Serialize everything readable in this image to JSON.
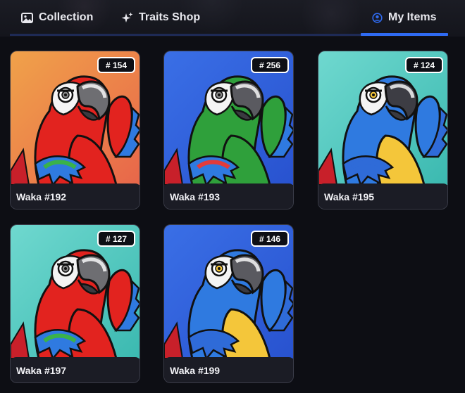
{
  "tabs": [
    {
      "label": "Collection",
      "icon": "image-icon",
      "active": false
    },
    {
      "label": "Traits Shop",
      "icon": "sparkles-icon",
      "active": false
    },
    {
      "label": "My Items",
      "icon": "user-circle-icon",
      "active": true
    }
  ],
  "colors": {
    "active_tab": "#2f6bf2",
    "background": "#0d0e14",
    "card_footer": "#1b1c25"
  },
  "items": [
    {
      "name": "Waka #192",
      "rank": "# 154",
      "bg": [
        "#f0a24a",
        "#e8664a"
      ],
      "body": "#e2231f",
      "beak": "#6e6e72",
      "wing": [
        "#2f7ae0",
        "#3ab24a"
      ],
      "chest": "#e2231f",
      "accent": "#ffffff"
    },
    {
      "name": "Waka #193",
      "rank": "# 256",
      "bg": [
        "#3a6fe6",
        "#2852cf"
      ],
      "body": "#2fa03b",
      "beak": "#5a5a60",
      "wing": [
        "#2f7ae0",
        "#e23b3b"
      ],
      "chest": "#2fa03b",
      "accent": "#e23b3b"
    },
    {
      "name": "Waka #195",
      "rank": "# 124",
      "bg": [
        "#6fd8cf",
        "#3bb9b0"
      ],
      "body": "#2f7ae0",
      "beak": "#3d3d44",
      "wing": [
        "#2f6bd8",
        "#2f6bd8"
      ],
      "chest": "#f4c63a",
      "accent": "#3ab24a"
    },
    {
      "name": "Waka #197",
      "rank": "# 127",
      "bg": [
        "#6fd8cf",
        "#3bb9b0"
      ],
      "body": "#e2231f",
      "beak": "#6e6e72",
      "wing": [
        "#2f7ae0",
        "#3ab24a"
      ],
      "chest": "#e2231f",
      "accent": "#ffffff"
    },
    {
      "name": "Waka #199",
      "rank": "# 146",
      "bg": [
        "#3a6fe6",
        "#2852cf"
      ],
      "body": "#2f7ae0",
      "beak": "#5a5a60",
      "wing": [
        "#2f6bd8",
        "#2f6bd8"
      ],
      "chest": "#f4c63a",
      "accent": "#3ab24a"
    }
  ]
}
